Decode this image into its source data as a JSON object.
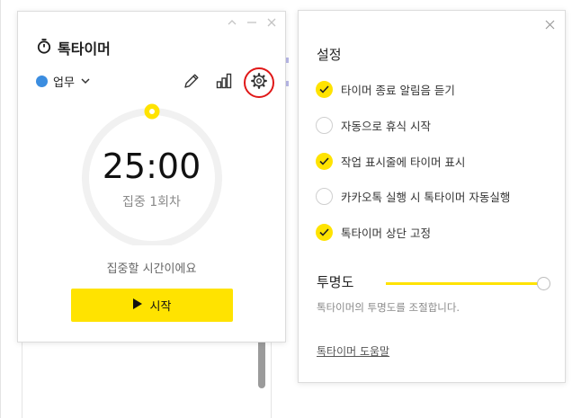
{
  "timer": {
    "app_title": "톡타이머",
    "category": {
      "label": "업무",
      "color": "#3b8de0"
    },
    "time": "25:00",
    "session": "집중 1회차",
    "hint": "집중할 시간이에요",
    "start_label": "시작",
    "progress": 0,
    "icons": {
      "title": "stopwatch-icon",
      "category": "chevron-down-icon",
      "edit": "pencil-icon",
      "stats": "bar-chart-icon",
      "settings": "gear-icon",
      "start": "play-icon",
      "window": [
        "minimize-up-icon",
        "minimize-icon",
        "close-icon"
      ]
    }
  },
  "settings": {
    "title": "설정",
    "options": [
      {
        "label": "타이머 종료 알림음 듣기",
        "checked": true
      },
      {
        "label": "자동으로 휴식 시작",
        "checked": false
      },
      {
        "label": "작업 표시줄에 타이머 표시",
        "checked": true
      },
      {
        "label": "카카오톡 실행 시 톡타이머 자동실행",
        "checked": false
      },
      {
        "label": "톡타이머 상단 고정",
        "checked": true
      }
    ],
    "opacity": {
      "title": "투명도",
      "value_percent": 100,
      "description": "톡타이머의 투명도를 조절합니다."
    },
    "help_link": "톡타이머 도움말"
  },
  "colors": {
    "accent_yellow": "#ffe300",
    "highlight_red": "#e01818",
    "ring_gray": "#f1f1f1"
  }
}
